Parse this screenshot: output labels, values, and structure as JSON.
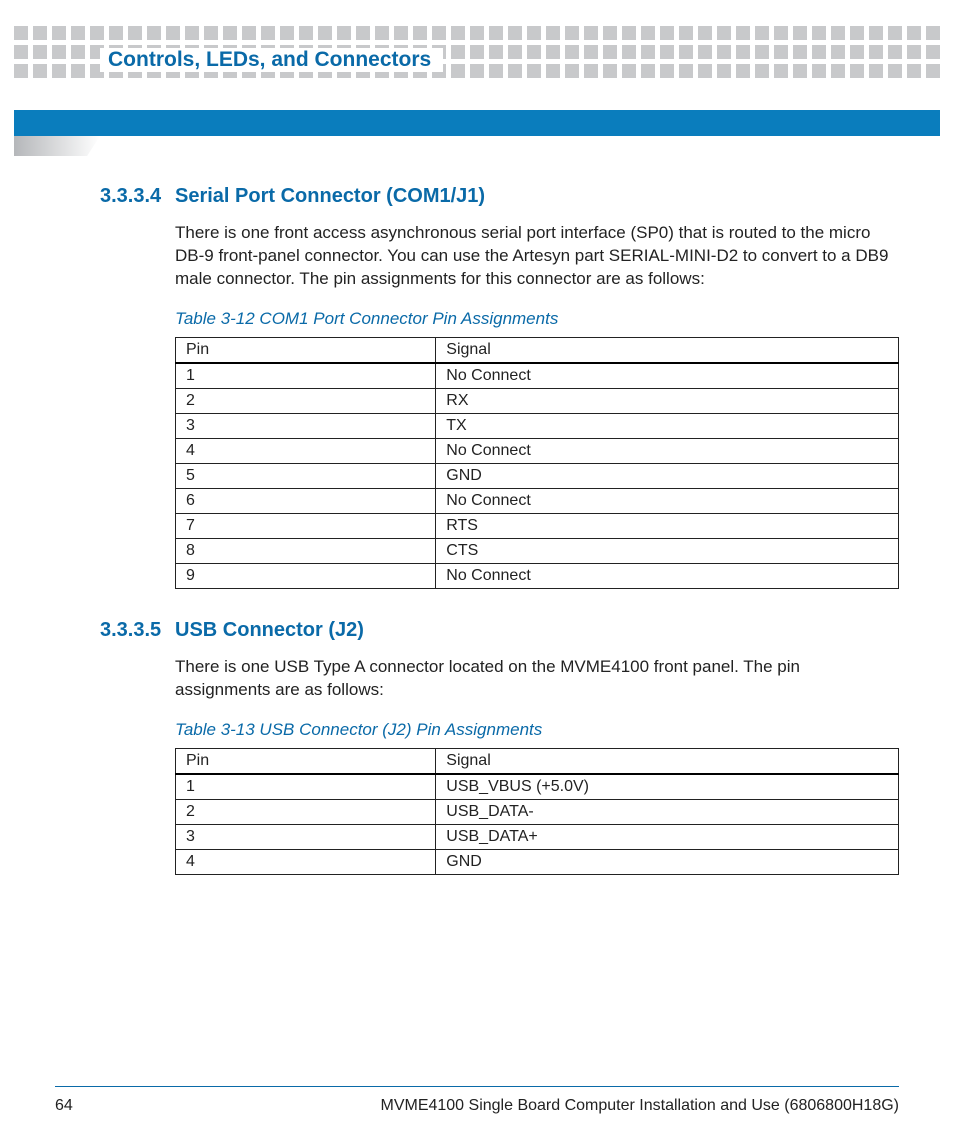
{
  "chapter_title": "Controls, LEDs, and Connectors",
  "sections": [
    {
      "num": "3.3.3.4",
      "title": "Serial Port Connector (COM1/J1)",
      "body": "There is one front access asynchronous serial port interface (SP0) that is routed to the micro DB-9 front-panel connector.   You can use the Artesyn part SERIAL-MINI-D2 to convert to a DB9 male connector. The pin assignments for this connector are as follows:",
      "table_caption": "Table 3-12 COM1 Port Connector Pin Assignments",
      "table": {
        "headers": [
          "Pin",
          "Signal"
        ],
        "rows": [
          [
            "1",
            "No Connect"
          ],
          [
            "2",
            "RX"
          ],
          [
            "3",
            "TX"
          ],
          [
            "4",
            "No Connect"
          ],
          [
            "5",
            "GND"
          ],
          [
            "6",
            "No Connect"
          ],
          [
            "7",
            "RTS"
          ],
          [
            "8",
            "CTS"
          ],
          [
            "9",
            "No Connect"
          ]
        ]
      }
    },
    {
      "num": "3.3.3.5",
      "title": "USB Connector (J2)",
      "body": "There is one USB Type A connector located on the MVME4100 front panel. The pin assignments are as follows:",
      "table_caption": "Table 3-13 USB Connector (J2) Pin Assignments",
      "table": {
        "headers": [
          "Pin",
          "Signal"
        ],
        "rows": [
          [
            "1",
            "USB_VBUS (+5.0V)"
          ],
          [
            "2",
            "USB_DATA-"
          ],
          [
            "3",
            "USB_DATA+"
          ],
          [
            "4",
            "GND"
          ]
        ]
      }
    }
  ],
  "footer": {
    "page_num": "64",
    "doc_title": "MVME4100 Single Board Computer Installation and Use (6806800H18G)"
  }
}
